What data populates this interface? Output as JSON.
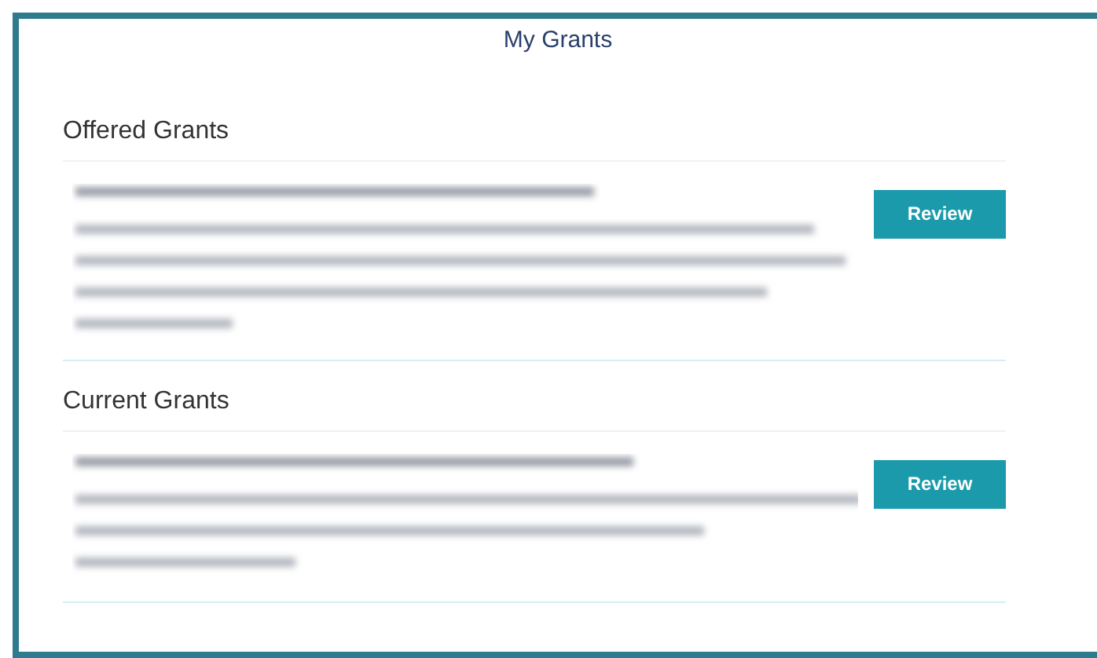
{
  "title": "My Grants",
  "sections": [
    {
      "heading": "Offered Grants",
      "button": "Review"
    },
    {
      "heading": "Current Grants",
      "button": "Review"
    }
  ]
}
